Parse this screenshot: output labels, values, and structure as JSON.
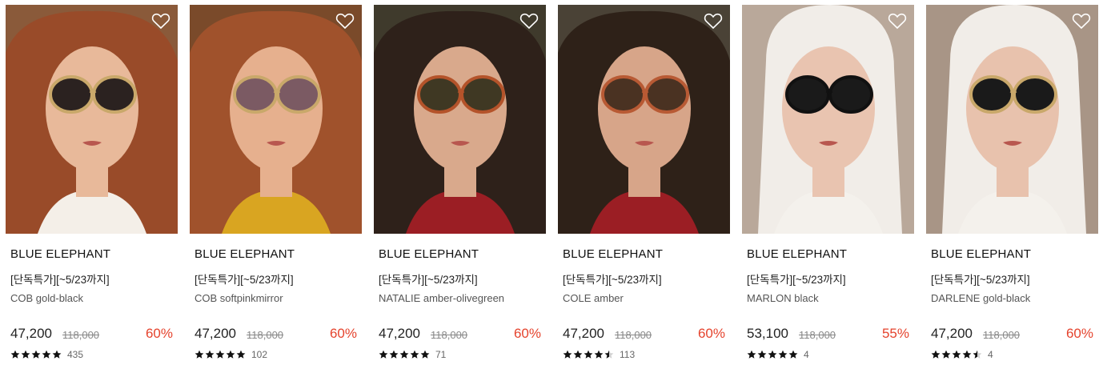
{
  "products": [
    {
      "brand": "BLUE ELEPHANT",
      "promo": "[단독특가][~5/23까지]",
      "name": "COB gold-black",
      "price": "47,200",
      "original_price": "118,000",
      "discount": "60%",
      "rating_stars": 5,
      "review_count": "435",
      "bg": "#8a5a3a",
      "hair": "#9a4a28",
      "skin": "#e8b99a",
      "lens": "#2b2220",
      "frame": "#c9a86a",
      "clothing": "#f4efe8"
    },
    {
      "brand": "BLUE ELEPHANT",
      "promo": "[단독특가][~5/23까지]",
      "name": "COB softpinkmirror",
      "price": "47,200",
      "original_price": "118,000",
      "discount": "60%",
      "rating_stars": 5,
      "review_count": "102",
      "bg": "#7a4a2a",
      "hair": "#a3532c",
      "skin": "#e6b08e",
      "lens": "#7b5a63",
      "frame": "#c9a86a",
      "clothing": "#d9a521"
    },
    {
      "brand": "BLUE ELEPHANT",
      "promo": "[단독특가][~5/23까지]",
      "name": "NATALIE amber-olivegreen",
      "price": "47,200",
      "original_price": "118,000",
      "discount": "60%",
      "rating_stars": 5,
      "review_count": "71",
      "bg": "#3f3a2c",
      "hair": "#2d2019",
      "skin": "#d9a98c",
      "lens": "#3f3823",
      "frame": "#b4532a",
      "clothing": "#9b1e24"
    },
    {
      "brand": "BLUE ELEPHANT",
      "promo": "[단독특가][~5/23까지]",
      "name": "COLE amber",
      "price": "47,200",
      "original_price": "118,000",
      "discount": "60%",
      "rating_stars": 4.5,
      "review_count": "113",
      "bg": "#4a4236",
      "hair": "#2b1e16",
      "skin": "#d7a589",
      "lens": "#4a3222",
      "frame": "#b85a34",
      "clothing": "#9b1e24"
    },
    {
      "brand": "BLUE ELEPHANT",
      "promo": "[단독특가][~5/23까지]",
      "name": "MARLON black",
      "price": "53,100",
      "original_price": "118,000",
      "discount": "55%",
      "rating_stars": 5,
      "review_count": "4",
      "bg": "#b9a89a",
      "hair": "#f1ede8",
      "skin": "#e9c4b0",
      "lens": "#1a1a1a",
      "frame": "#111111",
      "clothing": "#f4f1ec"
    },
    {
      "brand": "BLUE ELEPHANT",
      "promo": "[단독특가][~5/23까지]",
      "name": "DARLENE gold-black",
      "price": "47,200",
      "original_price": "118,000",
      "discount": "60%",
      "rating_stars": 4.5,
      "review_count": "4",
      "bg": "#a89586",
      "hair": "#f1ede8",
      "skin": "#e8c2ad",
      "lens": "#1a1a1a",
      "frame": "#c9a86a",
      "clothing": "#f4f1ec"
    }
  ]
}
